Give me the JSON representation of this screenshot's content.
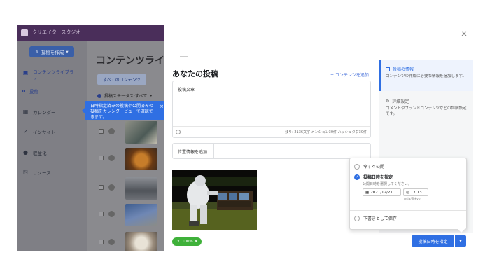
{
  "app": {
    "title": "クリエイタースタジオ"
  },
  "sidebar": {
    "create_button": "投稿を作成",
    "items": [
      {
        "label": "コンテンツライブラリ",
        "icon": "library-icon"
      },
      {
        "label": "投稿",
        "icon": "dot-icon"
      },
      {
        "label": "カレンダー",
        "icon": "calendar-icon"
      },
      {
        "label": "インサイト",
        "icon": "insights-icon"
      },
      {
        "label": "収益化",
        "icon": "dollar-icon"
      },
      {
        "label": "リソース",
        "icon": "resources-icon"
      }
    ]
  },
  "library": {
    "title": "コンテンツライブ",
    "tab": "すべてのコンテンツ",
    "filter": "投稿ステータス:すべて"
  },
  "tooltip": {
    "text": "日時指定済みの投稿や公開済みの投稿をカレンダービューで確認できます。",
    "close": "×"
  },
  "composer": {
    "close": "×",
    "title": "あなたの投稿",
    "add_content": "+ コンテンツを追加",
    "text_placeholder": "投稿文章",
    "counter": "残り: 2136文字 メンション30件 ハッシュタグ30件",
    "location_label": "位置情報を追加",
    "zoom": "100%"
  },
  "right_panel": {
    "post_info": {
      "title": "投稿の情報",
      "desc": "コンテンツの作成に必要な情報を追加します。"
    },
    "advanced": {
      "title": "詳細設定",
      "desc": "コメントやブランドコンテンツなどの詳細設定です。"
    }
  },
  "publish_options": {
    "now": "今すぐ公開",
    "schedule": "投稿日時を指定",
    "hint": "公開日時を選択してください。",
    "date": "2021/12/21",
    "time": "17:13",
    "timezone": "Asia/Tokyo",
    "draft": "下書きとして保存"
  },
  "footer": {
    "schedule_button": "投稿日時を指定"
  },
  "colors": {
    "accent": "#2f6fe3",
    "topbar": "#4a2e5a",
    "zoom_green": "#3fb13a"
  }
}
